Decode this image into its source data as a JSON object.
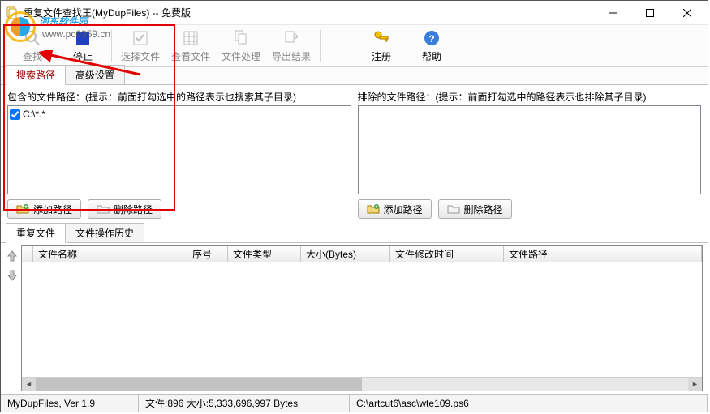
{
  "window": {
    "title": "重复文件查找王(MyDupFiles) -- 免费版"
  },
  "toolbar": {
    "scan": "查找",
    "stop": "停止",
    "select": "选择文件",
    "view": "查看文件",
    "process": "文件处理",
    "export": "导出结果",
    "register": "注册",
    "help": "帮助"
  },
  "tabs1": {
    "search": "搜索路径",
    "advanced": "高级设置"
  },
  "include": {
    "label": "包含的文件路径：(提示：前面打勾选中的路径表示也搜索其子目录)",
    "items": [
      {
        "checked": true,
        "text": "C:\\*.*"
      }
    ],
    "add": "添加路径",
    "del": "删除路径"
  },
  "exclude": {
    "label": "排除的文件路径：(提示：前面打勾选中的路径表示也排除其子目录)",
    "add": "添加路径",
    "del": "删除路径"
  },
  "tabs2": {
    "dup": "重复文件",
    "history": "文件操作历史"
  },
  "grid": {
    "cols": {
      "name": "文件名称",
      "no": "序号",
      "type": "文件类型",
      "size": "大小(Bytes)",
      "mtime": "文件修改时间",
      "path": "文件路径"
    }
  },
  "status": {
    "ver": "MyDupFiles, Ver 1.9",
    "counts": "文件:896  大小:5,333,696,997 Bytes",
    "cur": "C:\\artcut6\\asc\\wte109.ps6"
  },
  "watermark": {
    "brand": "河东软件园",
    "url": "www.pc0359.cn"
  }
}
